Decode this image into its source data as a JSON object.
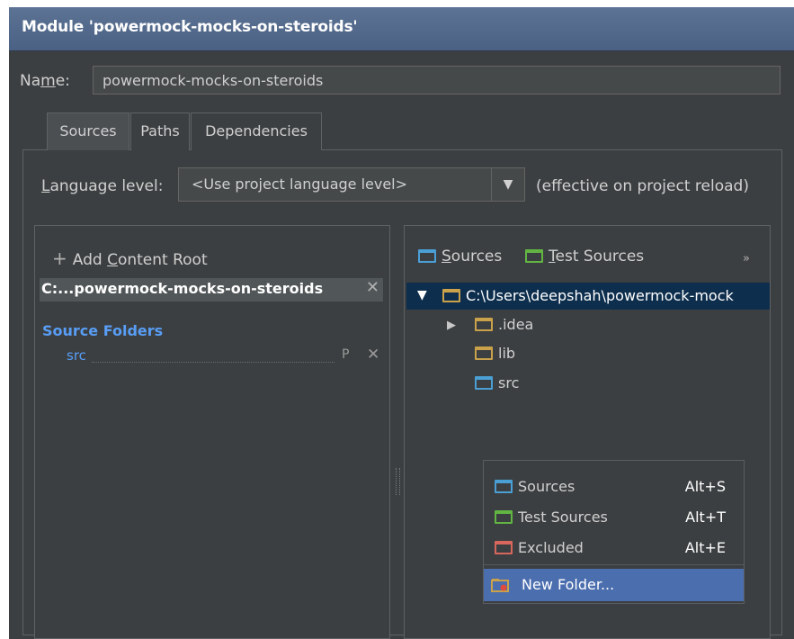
{
  "window": {
    "title": "Module 'powermock-mocks-on-steroids'"
  },
  "name_field": {
    "label_pre": "Na",
    "label_mnemonic": "m",
    "label_post": "e:",
    "value": "powermock-mocks-on-steroids"
  },
  "tabs": [
    {
      "label": "Sources",
      "selected": true
    },
    {
      "label": "Paths",
      "selected": false
    },
    {
      "label": "Dependencies",
      "selected": false
    }
  ],
  "language_level": {
    "label_mnemonic": "L",
    "label_rest": "anguage level:",
    "value": "<Use project language level>",
    "note": "(effective on project reload)"
  },
  "left_panel": {
    "add_root": {
      "pre": "Add ",
      "mnemonic": "C",
      "post": "ontent Root"
    },
    "root_path": "C:...powermock-mocks-on-steroids",
    "source_folders_label": "Source Folders",
    "source_items": [
      {
        "name": "src",
        "props_icon": "P",
        "remove_icon": "✕"
      }
    ]
  },
  "right_panel": {
    "mark_buttons": [
      {
        "mnemonic": "S",
        "rest": "ources",
        "color": "#4a9fd5",
        "icon": "folder-icon"
      },
      {
        "mnemonic": "T",
        "rest": "est Sources",
        "color": "#62b543",
        "icon": "folder-icon"
      }
    ],
    "more": "»",
    "tree": {
      "root": "C:\\Users\\deepshah\\powermock-mock",
      "children": [
        {
          "name": ".idea",
          "expandable": true,
          "icon_color": "#c9a24b"
        },
        {
          "name": "lib",
          "expandable": false,
          "icon_color": "#c9a24b"
        },
        {
          "name": "src",
          "expandable": false,
          "icon_color": "#4a9fd5"
        }
      ]
    }
  },
  "context_menu": {
    "items": [
      {
        "label": "Sources",
        "shortcut": "Alt+S",
        "icon_color": "#4a9fd5"
      },
      {
        "label": "Test Sources",
        "shortcut": "Alt+T",
        "icon_color": "#62b543"
      },
      {
        "label": "Excluded",
        "shortcut": "Alt+E",
        "icon_color": "#d9665d"
      }
    ],
    "new_folder": "New Folder..."
  }
}
